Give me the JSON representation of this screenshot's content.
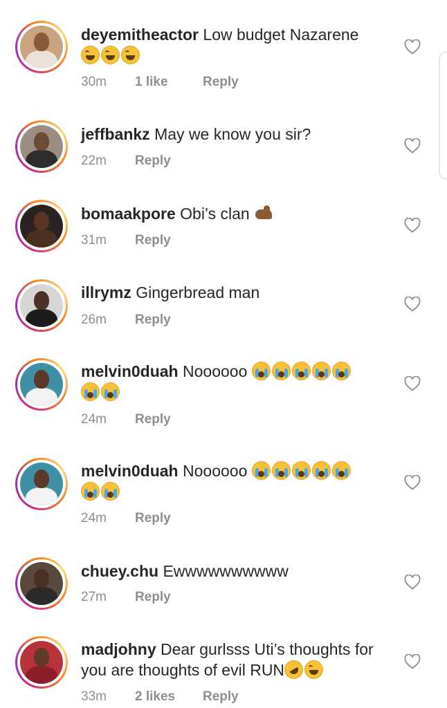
{
  "comments": [
    {
      "username": "deyemitheactor",
      "text": "Low budget Nazarene",
      "emoji": [
        "laugh",
        "laugh",
        "laugh"
      ],
      "time": "30m",
      "likes": "1 like",
      "reply": "Reply",
      "avatar_skin": "#8a5a3c",
      "avatar_shirt": "#e9e1d8",
      "avatar_bg": "#c9a27e"
    },
    {
      "username": "jeffbankz",
      "text": "May we know you sir?",
      "emoji": [],
      "time": "22m",
      "likes": "",
      "reply": "Reply",
      "avatar_skin": "#6b4a36",
      "avatar_shirt": "#2d2d2d",
      "avatar_bg": "#9c8d82"
    },
    {
      "username": "bomaakpore",
      "text": "Obi’s clan",
      "emoji": [
        "muscle"
      ],
      "time": "31m",
      "likes": "",
      "reply": "Reply",
      "avatar_skin": "#5a3422",
      "avatar_shirt": "#4a2e1e",
      "avatar_bg": "#2a2220"
    },
    {
      "username": "illrymz",
      "text": "Gingerbread man",
      "emoji": [],
      "time": "26m",
      "likes": "",
      "reply": "Reply",
      "avatar_skin": "#4a3326",
      "avatar_shirt": "#1c1c1c",
      "avatar_bg": "#d6d6d6"
    },
    {
      "username": "melvin0duah",
      "text": "Noooooo",
      "emoji": [
        "cry",
        "cry",
        "cry",
        "cry",
        "cry",
        "cry",
        "cry"
      ],
      "time": "24m",
      "likes": "",
      "reply": "Reply",
      "avatar_skin": "#5b3a28",
      "avatar_shirt": "#f2f2f2",
      "avatar_bg": "#3f8fa5"
    },
    {
      "username": "melvin0duah",
      "text": "Noooooo",
      "emoji": [
        "cry",
        "cry",
        "cry",
        "cry",
        "cry",
        "cry",
        "cry"
      ],
      "time": "24m",
      "likes": "",
      "reply": "Reply",
      "avatar_skin": "#5b3a28",
      "avatar_shirt": "#f2f2f2",
      "avatar_bg": "#3f8fa5"
    },
    {
      "username": "chuey.chu",
      "text": "Ewwwwwwwwww",
      "emoji": [],
      "time": "27m",
      "likes": "",
      "reply": "Reply",
      "avatar_skin": "#4b2f22",
      "avatar_shirt": "#2a2a2a",
      "avatar_bg": "#5a4a3c"
    },
    {
      "username": "madjohny",
      "text": "Dear gurlsss Uti’s thoughts for you are thoughts of evil RUN",
      "emoji": [
        "rofl",
        "laugh"
      ],
      "time": "33m",
      "likes": "2 likes",
      "reply": "Reply",
      "avatar_skin": "#5e3a28",
      "avatar_shirt": "#8a1f2a",
      "avatar_bg": "#b8323c"
    }
  ],
  "colors": {
    "accent_ring": "#d62976",
    "meta_gray": "#8e8e8e",
    "text": "#262626"
  }
}
